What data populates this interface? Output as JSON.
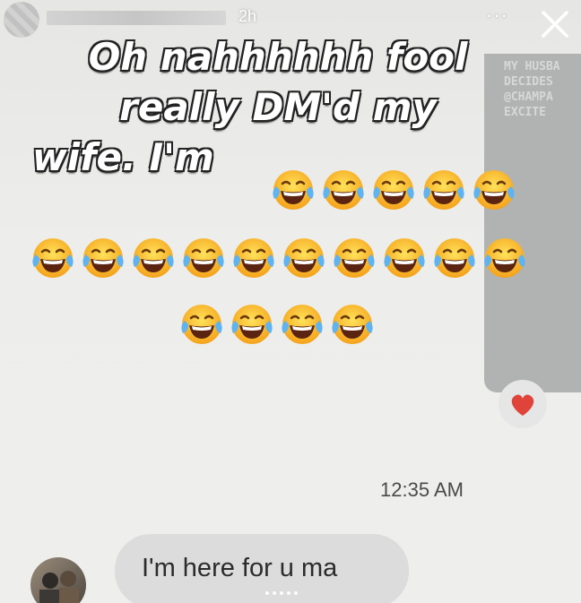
{
  "story": {
    "posted_ago": "2h",
    "more_label": "···",
    "close_icon": "close-icon"
  },
  "caption": {
    "line1": "Oh nahhhhhh fool",
    "line2": "really DM'd my",
    "line3": "wife. I'm"
  },
  "emoji": {
    "name": "face-with-tears-of-joy-emoji",
    "row1_count": 5,
    "row2_count": 10,
    "row3_count": 4
  },
  "watermark": {
    "text": "MY HUSBA\nDECIDES\n@CHAMPA\nEXCITE"
  },
  "chat": {
    "reaction": "heart-icon",
    "timestamp": "12:35 AM",
    "message": "I'm here for u ma"
  },
  "colors": {
    "caption_text": "#ffffff",
    "caption_outline": "#222222",
    "side_panel": "#b1b3b3",
    "heart": "#e0433a",
    "bubble": "#dcdcdc"
  }
}
